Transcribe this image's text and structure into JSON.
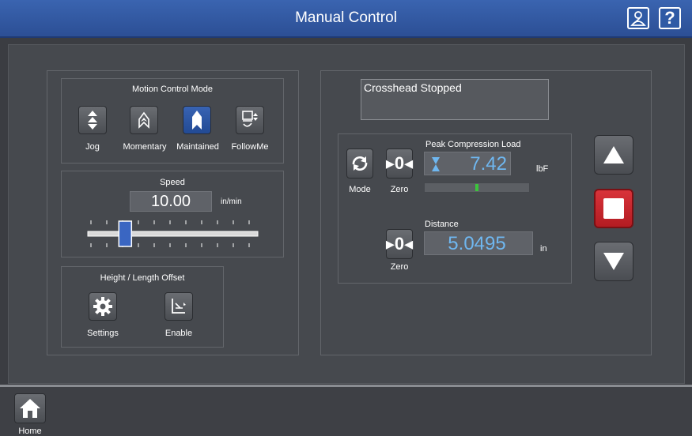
{
  "header": {
    "title": "Manual Control"
  },
  "motion_mode": {
    "title": "Motion Control Mode",
    "modes": [
      {
        "label": "Jog",
        "icon": "jog-icon"
      },
      {
        "label": "Momentary",
        "icon": "momentary-icon"
      },
      {
        "label": "Maintained",
        "icon": "maintained-icon",
        "selected": true
      },
      {
        "label": "FollowMe",
        "icon": "followme-icon"
      }
    ]
  },
  "speed": {
    "title": "Speed",
    "value": "10.00",
    "unit": "in/min",
    "slider_level": 0.22
  },
  "offset": {
    "title": "Height / Length Offset",
    "settings_label": "Settings",
    "enable_label": "Enable"
  },
  "status": {
    "text": "Crosshead Stopped"
  },
  "load": {
    "title": "Peak Compression Load",
    "value": "7.42",
    "unit": "lbF",
    "mode_label": "Mode",
    "zero_label": "Zero",
    "bar_level": 0.5
  },
  "distance": {
    "title": "Distance",
    "value": "5.0495",
    "unit": "in",
    "zero_label": "Zero"
  },
  "footer": {
    "home_label": "Home"
  },
  "colors": {
    "accent": "#2c4f95",
    "value_text": "#6fb7f0",
    "stop_red": "#c8242a",
    "bar_green": "#3cc43c"
  }
}
